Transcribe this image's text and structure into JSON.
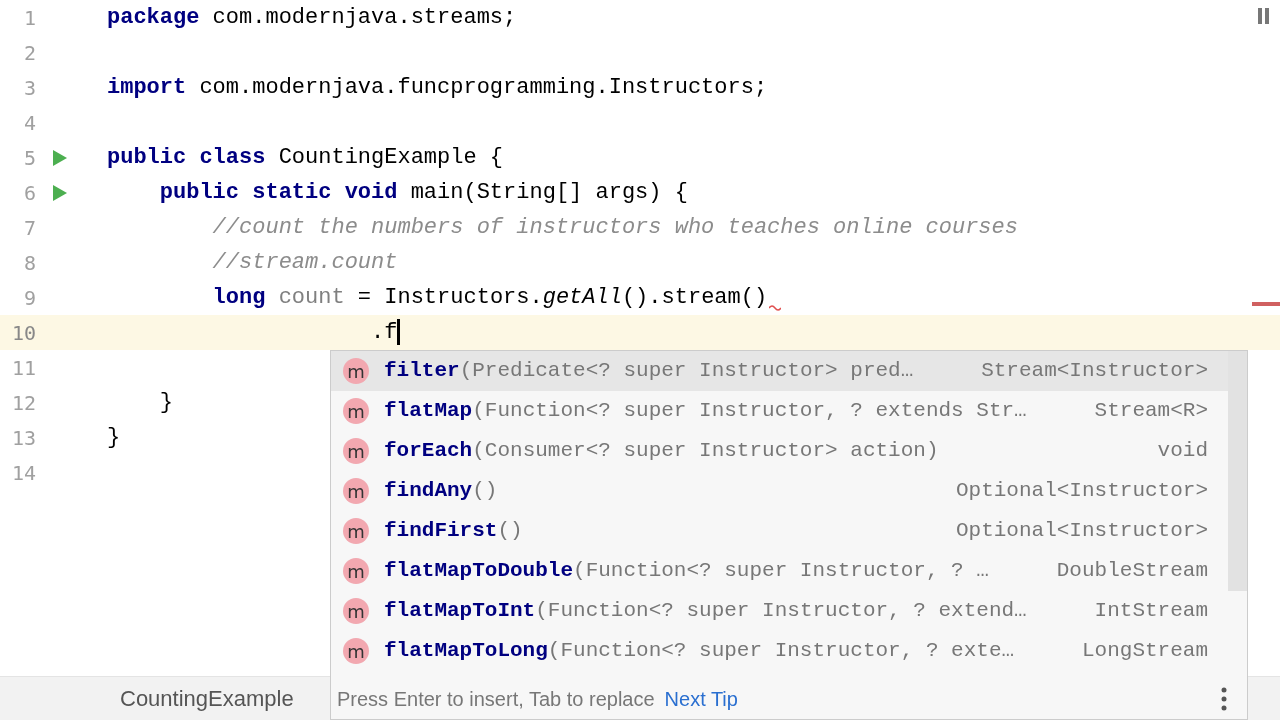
{
  "editor": {
    "lines": [
      {
        "number": "1",
        "current": false,
        "tokens": [
          {
            "kind": "keyword",
            "text": "package"
          },
          {
            "kind": "plain",
            "text": " com.modernjava.streams;"
          }
        ]
      },
      {
        "number": "2",
        "current": false
      },
      {
        "number": "3",
        "current": false,
        "tokens": [
          {
            "kind": "keyword",
            "text": "import"
          },
          {
            "kind": "plain",
            "text": " com.modernjava.funcprogramming.Instructors;"
          }
        ]
      },
      {
        "number": "4",
        "current": false
      },
      {
        "number": "5",
        "run": true,
        "current": false,
        "tokens": [
          {
            "kind": "keyword",
            "text": "public class"
          },
          {
            "kind": "plain",
            "text": " CountingExample {"
          }
        ]
      },
      {
        "number": "6",
        "run": true,
        "current": false,
        "tokens": [
          {
            "kind": "keyword",
            "text": "    public static void"
          },
          {
            "kind": "plain",
            "text": " main(String[] args) {"
          }
        ]
      },
      {
        "number": "7",
        "current": false,
        "tokens": [
          {
            "kind": "comment",
            "text": "        //count the numbers of instructors who teaches online courses"
          }
        ]
      },
      {
        "number": "8",
        "current": false,
        "tokens": [
          {
            "kind": "comment",
            "text": "        //stream.count"
          }
        ]
      },
      {
        "number": "9",
        "current": false,
        "error": true,
        "tokens": [
          {
            "kind": "keyword",
            "text": "        long "
          },
          {
            "kind": "unused",
            "text": "count"
          },
          {
            "kind": "plain",
            "text": " = Instructors."
          },
          {
            "kind": "static",
            "text": "getAll"
          },
          {
            "kind": "plain",
            "text": "().stream()"
          }
        ]
      },
      {
        "number": "10",
        "current": true,
        "tokens": [
          {
            "kind": "plain",
            "text": "                    .f"
          }
        ]
      },
      {
        "number": "11",
        "current": false
      },
      {
        "number": "12",
        "current": false,
        "tokens": [
          {
            "kind": "plain",
            "text": "    }"
          }
        ]
      },
      {
        "number": "13",
        "current": false,
        "tokens": [
          {
            "kind": "plain",
            "text": "}"
          }
        ]
      },
      {
        "number": "14",
        "current": false
      }
    ]
  },
  "completion": {
    "items": [
      {
        "badge": "m",
        "name": "filter",
        "params": "(Predicate<? super Instructor> pred…",
        "type": "Stream<Instructor>",
        "selected": true
      },
      {
        "badge": "m",
        "name": "flatMap",
        "params": "(Function<? super Instructor, ? extends Str…",
        "type": "Stream<R>",
        "selected": false
      },
      {
        "badge": "m",
        "name": "forEach",
        "params": "(Consumer<? super Instructor> action)",
        "type": "void",
        "selected": false
      },
      {
        "badge": "m",
        "name": "findAny",
        "params": "()",
        "type": "Optional<Instructor>",
        "selected": false
      },
      {
        "badge": "m",
        "name": "findFirst",
        "params": "()",
        "type": "Optional<Instructor>",
        "selected": false
      },
      {
        "badge": "m",
        "name": "flatMapToDouble",
        "params": "(Function<? super Instructor, ? …",
        "type": "DoubleStream",
        "selected": false
      },
      {
        "badge": "m",
        "name": "flatMapToInt",
        "params": "(Function<? super Instructor, ? extend…",
        "type": "IntStream",
        "selected": false
      },
      {
        "badge": "m",
        "name": "flatMapToLong",
        "params": "(Function<? super Instructor, ? exte…",
        "type": "LongStream",
        "selected": false
      }
    ],
    "hint": "Press Enter to insert, Tab to replace",
    "tip_link": "Next Tip"
  },
  "breadcrumb": "CountingExample"
}
